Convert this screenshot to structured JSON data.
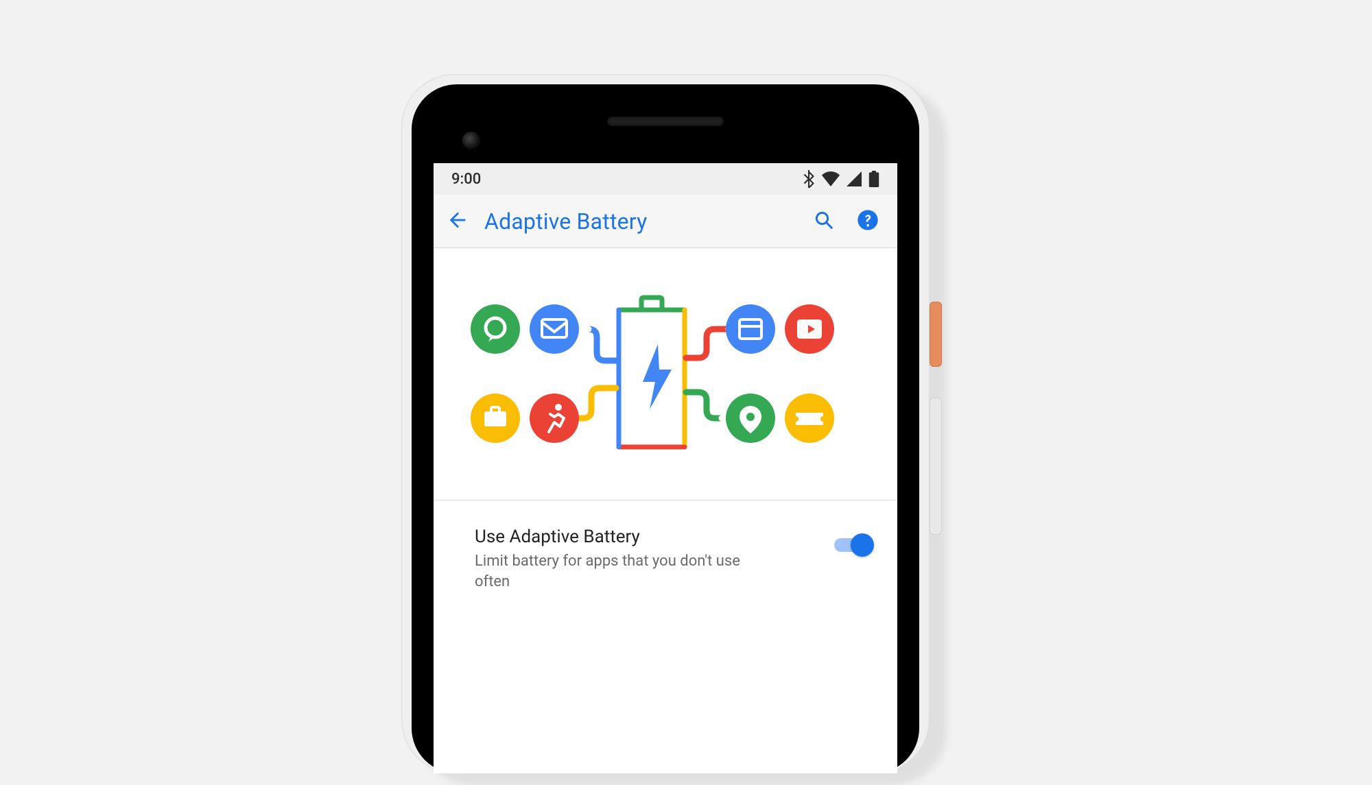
{
  "statusbar": {
    "time": "9:00"
  },
  "appbar": {
    "title": "Adaptive Battery"
  },
  "setting": {
    "title": "Use Adaptive Battery",
    "subtitle": "Limit battery for apps that you don't use often",
    "enabled": true
  },
  "colors": {
    "accent": "#1a73e8",
    "green": "#34a853",
    "red": "#ea4335",
    "yellow": "#fbbc04",
    "blue": "#4285f4"
  }
}
